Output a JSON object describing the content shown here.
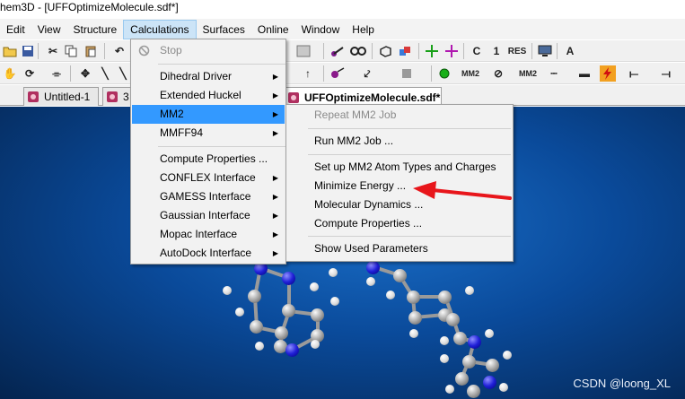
{
  "window": {
    "title": "hem3D - [UFFOptimizeMolecule.sdf*]"
  },
  "menubar": {
    "items": [
      "Edit",
      "View",
      "Structure",
      "Calculations",
      "Surfaces",
      "Online",
      "Window",
      "Help"
    ],
    "active": "Calculations"
  },
  "toolbar_row1": {
    "labels": [
      "MM2",
      "C",
      "1",
      "RES"
    ]
  },
  "toolbar_row2": {
    "labels": [
      "MM2",
      "MM2"
    ]
  },
  "tabs": [
    {
      "label": "Untitled-1"
    },
    {
      "label": "3"
    },
    {
      "label": "UFFOptimizeMolecule.sdf*"
    }
  ],
  "calculations_menu": {
    "items": [
      {
        "label": "Stop",
        "disabled": true,
        "icon": "stop-icon"
      },
      {
        "label": "Dihedral Driver",
        "submenu": true
      },
      {
        "label": "Extended Huckel",
        "submenu": true
      },
      {
        "label": "MM2",
        "submenu": true,
        "highlighted": true
      },
      {
        "label": "MMFF94",
        "submenu": true
      },
      {
        "label": "Compute Properties ..."
      },
      {
        "label": "CONFLEX Interface",
        "submenu": true
      },
      {
        "label": "GAMESS Interface",
        "submenu": true
      },
      {
        "label": "Gaussian Interface",
        "submenu": true
      },
      {
        "label": "Mopac Interface",
        "submenu": true
      },
      {
        "label": "AutoDock Interface",
        "submenu": true
      }
    ]
  },
  "mm2_submenu": {
    "items": [
      {
        "label": "Repeat MM2 Job",
        "disabled": true
      },
      {
        "label": "Run MM2 Job ..."
      },
      {
        "label": "Set up MM2 Atom Types and Charges"
      },
      {
        "label": "Minimize Energy ...",
        "annotated": true
      },
      {
        "label": "Molecular Dynamics ..."
      },
      {
        "label": "Compute Properties ..."
      },
      {
        "label": "Show Used Parameters"
      }
    ]
  },
  "annotation": {
    "arrow_color": "#e8161b",
    "points_to": "Minimize Energy ..."
  },
  "watermark": {
    "text": "CSDN @loong_XL"
  },
  "colors": {
    "menu_highlight": "#3399ff",
    "canvas_blue": "#0a4a9a",
    "nitrogen": "#2020d8",
    "tab_icon": "#b03060"
  }
}
